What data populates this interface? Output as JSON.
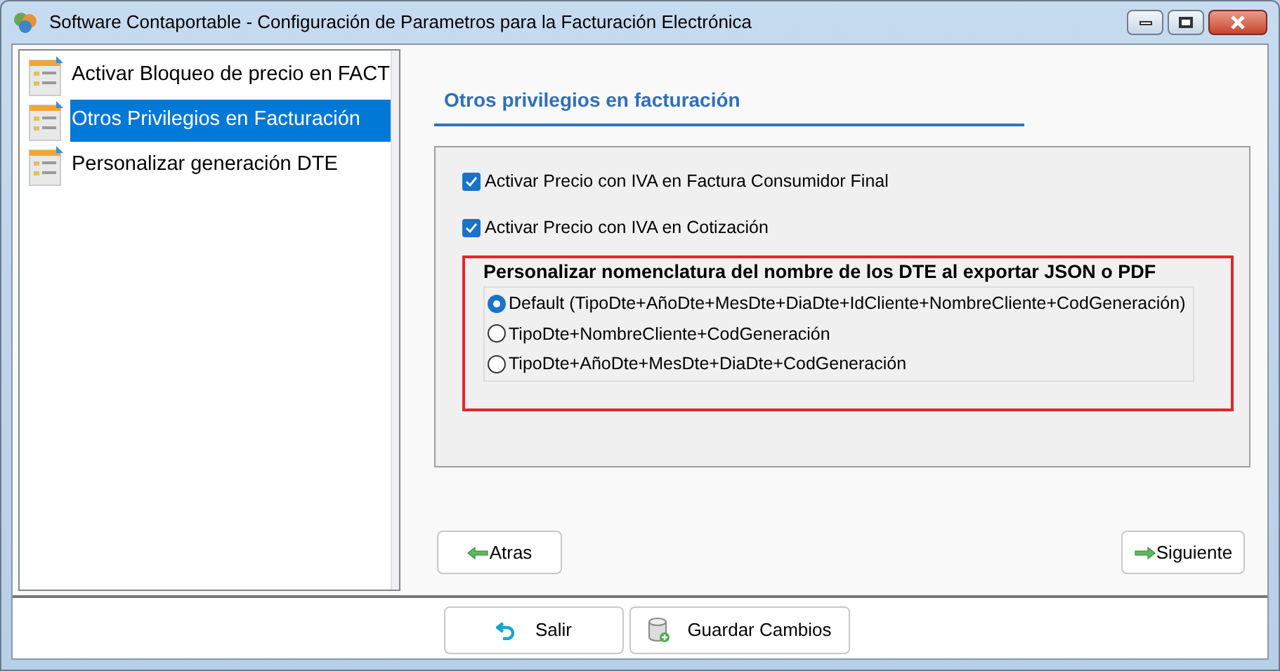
{
  "window": {
    "title": "Software Contaportable - Configuración de Parametros para la Facturación Electrónica"
  },
  "sidebar": {
    "items": [
      {
        "label": "Activar Bloqueo de precio en FACT",
        "selected": false
      },
      {
        "label": "Otros Privilegios en Facturación",
        "selected": true
      },
      {
        "label": "Personalizar generación DTE",
        "selected": false
      }
    ]
  },
  "section": {
    "title": "Otros privilegios en facturación"
  },
  "checkboxes": [
    {
      "label": "Activar Precio con IVA en Factura Consumidor Final",
      "checked": true
    },
    {
      "label": "Activar Precio con IVA en Cotización",
      "checked": true
    }
  ],
  "naming": {
    "title": "Personalizar nomenclatura del nombre de los DTE al exportar JSON o PDF",
    "options": [
      {
        "label": "Default (TipoDte+AñoDte+MesDte+DiaDte+IdCliente+NombreCliente+CodGeneración)",
        "selected": true
      },
      {
        "label": "TipoDte+NombreCliente+CodGeneración",
        "selected": false
      },
      {
        "label": "TipoDte+AñoDte+MesDte+DiaDte+CodGeneración",
        "selected": false
      }
    ]
  },
  "nav": {
    "back": "Atras",
    "next": "Siguiente"
  },
  "footer": {
    "exit": "Salir",
    "save": "Guardar Cambios"
  }
}
